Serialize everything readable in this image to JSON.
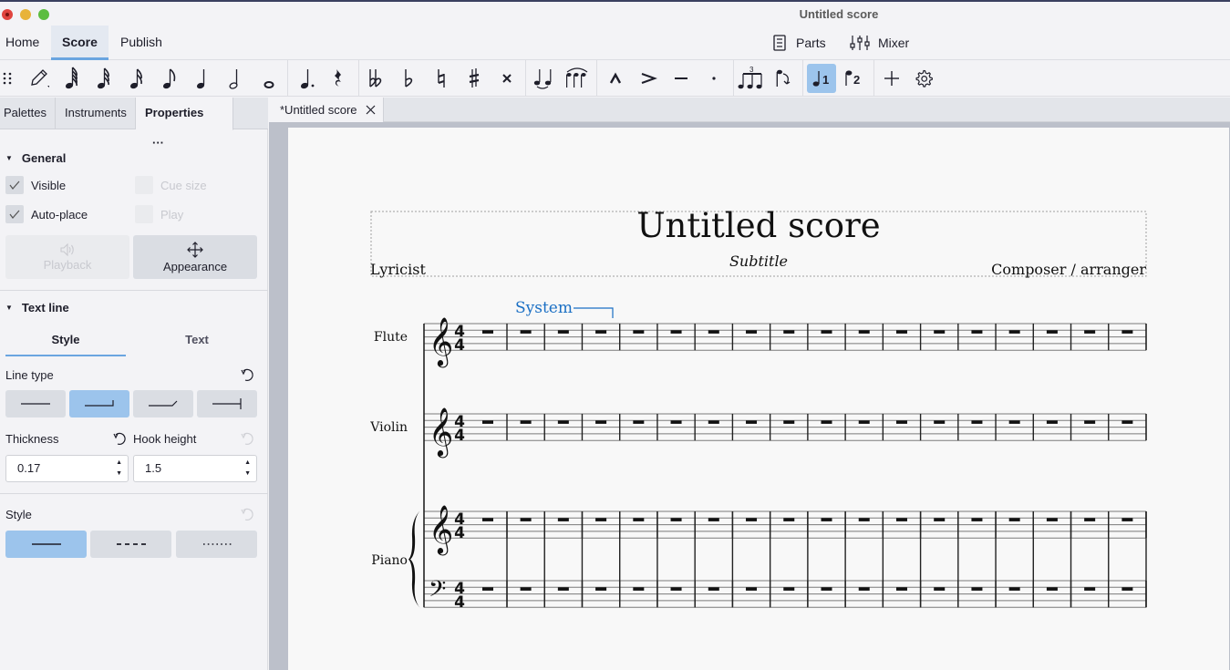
{
  "window": {
    "title": "Untitled score"
  },
  "menubar": {
    "tabs": [
      {
        "label": "Home",
        "active": false
      },
      {
        "label": "Score",
        "active": true
      },
      {
        "label": "Publish",
        "active": false
      }
    ],
    "parts_label": "Parts",
    "mixer_label": "Mixer"
  },
  "toolbar": {
    "items": [
      {
        "name": "drag-handle-icon"
      },
      {
        "name": "note-input-pencil-icon"
      },
      {
        "name": "sixty-fourth-note-icon"
      },
      {
        "name": "thirty-second-note-icon"
      },
      {
        "name": "sixteenth-note-icon"
      },
      {
        "name": "eighth-note-icon"
      },
      {
        "name": "quarter-note-icon"
      },
      {
        "name": "half-note-icon"
      },
      {
        "name": "whole-note-icon"
      },
      {
        "name": "augmentation-dot-icon"
      },
      {
        "name": "rest-icon"
      },
      {
        "name": "double-flat-icon"
      },
      {
        "name": "flat-icon"
      },
      {
        "name": "natural-icon"
      },
      {
        "name": "sharp-icon"
      },
      {
        "name": "double-sharp-icon"
      },
      {
        "name": "tie-icon"
      },
      {
        "name": "slur-icon"
      },
      {
        "name": "marcato-icon"
      },
      {
        "name": "accent-icon"
      },
      {
        "name": "tenuto-icon"
      },
      {
        "name": "staccato-icon"
      },
      {
        "name": "tuplet-icon"
      },
      {
        "name": "flip-direction-icon"
      },
      {
        "name": "voice-1-icon",
        "active": true
      },
      {
        "name": "voice-2-icon"
      },
      {
        "name": "add-icon"
      },
      {
        "name": "customize-toolbar-gear-icon"
      }
    ],
    "tuplet_number": "3",
    "voice1_number": "1",
    "voice2_number": "2"
  },
  "panel": {
    "tabs": [
      {
        "label": "Palettes",
        "active": false
      },
      {
        "label": "Instruments",
        "active": false
      },
      {
        "label": "Properties",
        "active": true
      }
    ],
    "more_label": "···",
    "general": {
      "title": "General",
      "visible": {
        "label": "Visible",
        "checked": true
      },
      "cue_size": {
        "label": "Cue size",
        "checked": false,
        "disabled": true
      },
      "auto_place": {
        "label": "Auto-place",
        "checked": true
      },
      "play": {
        "label": "Play",
        "checked": false,
        "disabled": true
      },
      "playback_label": "Playback",
      "appearance_label": "Appearance"
    },
    "text_line": {
      "title": "Text line",
      "subtabs": [
        {
          "label": "Style",
          "active": true
        },
        {
          "label": "Text",
          "active": false
        }
      ],
      "line_type_label": "Line type",
      "line_types": [
        {
          "name": "line-plain",
          "active": false
        },
        {
          "name": "line-hook-down",
          "active": true
        },
        {
          "name": "line-hook-angled",
          "active": false
        },
        {
          "name": "line-hook-end-bar",
          "active": false
        }
      ],
      "thickness_label": "Thickness",
      "thickness_value": "0.17",
      "hook_height_label": "Hook height",
      "hook_height_value": "1.5",
      "style_label": "Style",
      "styles": [
        {
          "name": "style-solid",
          "active": true
        },
        {
          "name": "style-dashed",
          "active": false
        },
        {
          "name": "style-dotted",
          "active": false
        }
      ]
    }
  },
  "document_tab": {
    "label": "*Untitled score"
  },
  "score": {
    "title": "Untitled score",
    "subtitle": "Subtitle",
    "lyricist": "Lyricist",
    "composer": "Composer / arranger",
    "system_text": "System",
    "time_signature": {
      "numerator": "4",
      "denominator": "4"
    },
    "measure_count": 18,
    "instruments": [
      {
        "name": "Flute",
        "staves": [
          "treble"
        ]
      },
      {
        "name": "Violin",
        "staves": [
          "treble"
        ]
      },
      {
        "name": "Piano",
        "staves": [
          "treble",
          "bass"
        ]
      }
    ],
    "accent_color": "#1a6fc4"
  },
  "colors": {
    "accent": "#9cc4ec",
    "tab_underline": "#6aa5e0",
    "system_text": "#1a6fc4"
  }
}
